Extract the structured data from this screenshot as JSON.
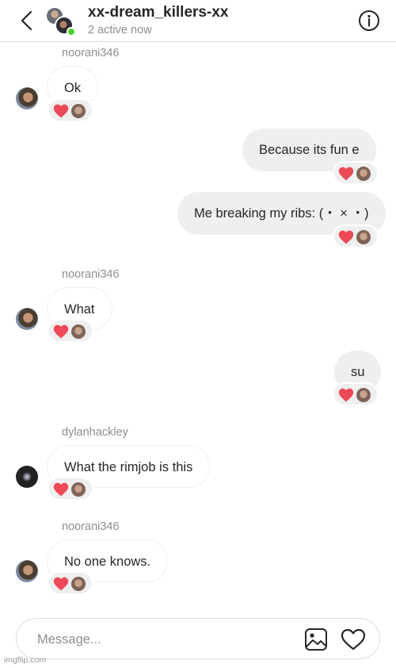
{
  "header": {
    "title": "xx-dream_killers-xx",
    "subtitle": "2 active now"
  },
  "messages": [
    {
      "username": "noorani346",
      "text": "Ok"
    },
    {
      "text": "Because its fun e"
    },
    {
      "text": "Me breaking my ribs: (・ × ・)"
    },
    {
      "username": "noorani346",
      "text": "What"
    },
    {
      "text": "su"
    },
    {
      "username": "dylanhackley",
      "text": "What the rimjob is this"
    },
    {
      "username": "noorani346",
      "text": "No one knows."
    }
  ],
  "reaction": {
    "emoji": "heart",
    "color": "#ed4956"
  },
  "composer": {
    "placeholder": "Message..."
  },
  "watermark": "imgflip.com",
  "colors": {
    "online": "#4ad22e",
    "sent_bubble": "#efefef",
    "muted_text": "#8e8e8e"
  }
}
